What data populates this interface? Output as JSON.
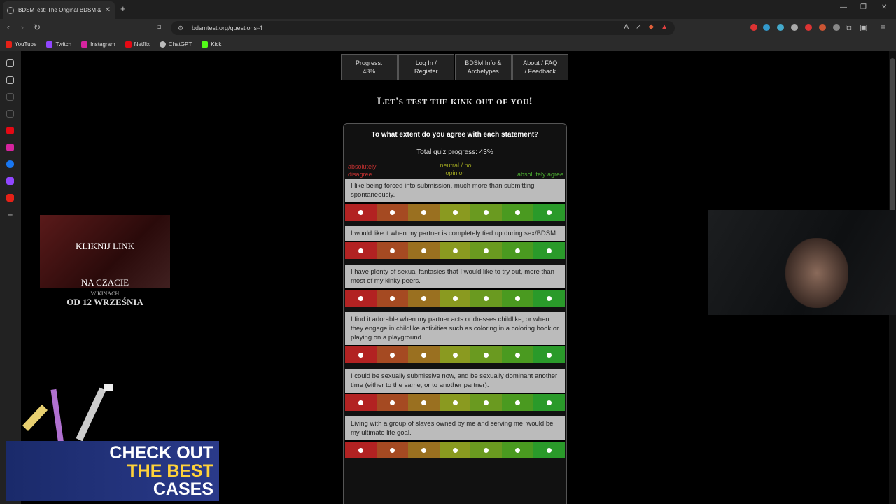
{
  "browser": {
    "tab_title": "BDSMTest: The Original BDSM &",
    "url": "bdsmtest.org/questions-4",
    "bookmarks": [
      {
        "label": "YouTube",
        "color": "#e62117"
      },
      {
        "label": "Twitch",
        "color": "#9146ff"
      },
      {
        "label": "Instagram",
        "color": "#d6249f"
      },
      {
        "label": "Netflix",
        "color": "#e50914"
      },
      {
        "label": "ChatGPT",
        "color": "#bbbbbb"
      },
      {
        "label": "Kick",
        "color": "#53fc18"
      }
    ]
  },
  "page": {
    "nav": [
      "Progress:\n43%",
      "Log In /\nRegister",
      "BDSM Info &\nArchetypes",
      "About / FAQ\n/ Feedback"
    ],
    "headline": "Let's test the kink out of you!",
    "quiz": {
      "question": "To what extent do you agree with each statement?",
      "progress": "Total quiz progress: 43%",
      "scale_left": "absolutely\ndisagree",
      "scale_mid": "neutral / no\nopinion",
      "scale_right": "absolutely agree",
      "answer_colors": [
        "#b22222",
        "#a54a22",
        "#9a7020",
        "#8a9a20",
        "#6a9a20",
        "#4a9a20",
        "#2a9a2a"
      ],
      "statements": [
        "I like being forced into submission, much more than submitting spontaneously.",
        "I would like it when my partner is completely tied up during sex/BDSM.",
        "I have plenty of sexual fantasies that I would like to try out, more than most of my kinky peers.",
        "I find it adorable when my partner acts or dresses childlike, or when they engage in childlike activities such as coloring in a coloring book or playing on a playground.",
        "I could be sexually submissive now, and be sexually dominant another time (either to the same, or to another partner).",
        "Living with a group of slaves owned by me and serving me, would be my ultimate life goal."
      ]
    }
  },
  "overlays": {
    "ad_line1": "KLIKNIJ LINK",
    "ad_line2": "NA CZACIE",
    "ad_line3": "W KINACH",
    "ad_line4": "OD 12 WRZEŚNIA",
    "cases_line1": "CHECK OUT",
    "cases_line2": "THE BEST",
    "cases_line3": "CASES"
  }
}
